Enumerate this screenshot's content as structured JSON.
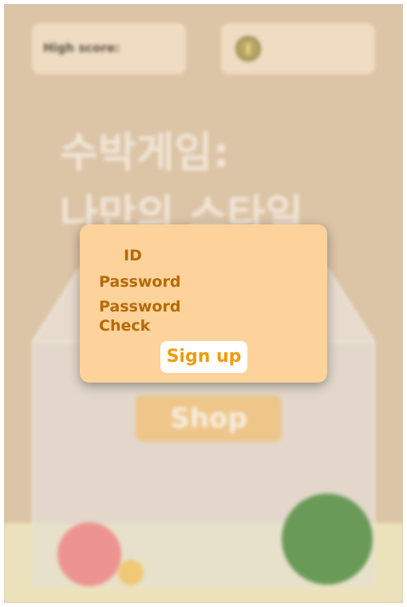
{
  "hud": {
    "high_score_label": "High score:",
    "coin_icon": "coin-icon"
  },
  "game": {
    "title_line1": "수박게임:",
    "title_line2": "나만의 스타일",
    "shop_label": "Shop"
  },
  "signup_dialog": {
    "id_label": "ID",
    "password_label": "Password",
    "password_check_label": "Password Check",
    "signup_button": "Sign up"
  },
  "colors": {
    "background": "#dcc4a6",
    "dialog": "#fdd29b",
    "dialog_text": "#b56a06",
    "button_text": "#f29b0a",
    "watermelon": "#6a9a57",
    "peach": "#ee9490",
    "orange": "#f1c875"
  }
}
